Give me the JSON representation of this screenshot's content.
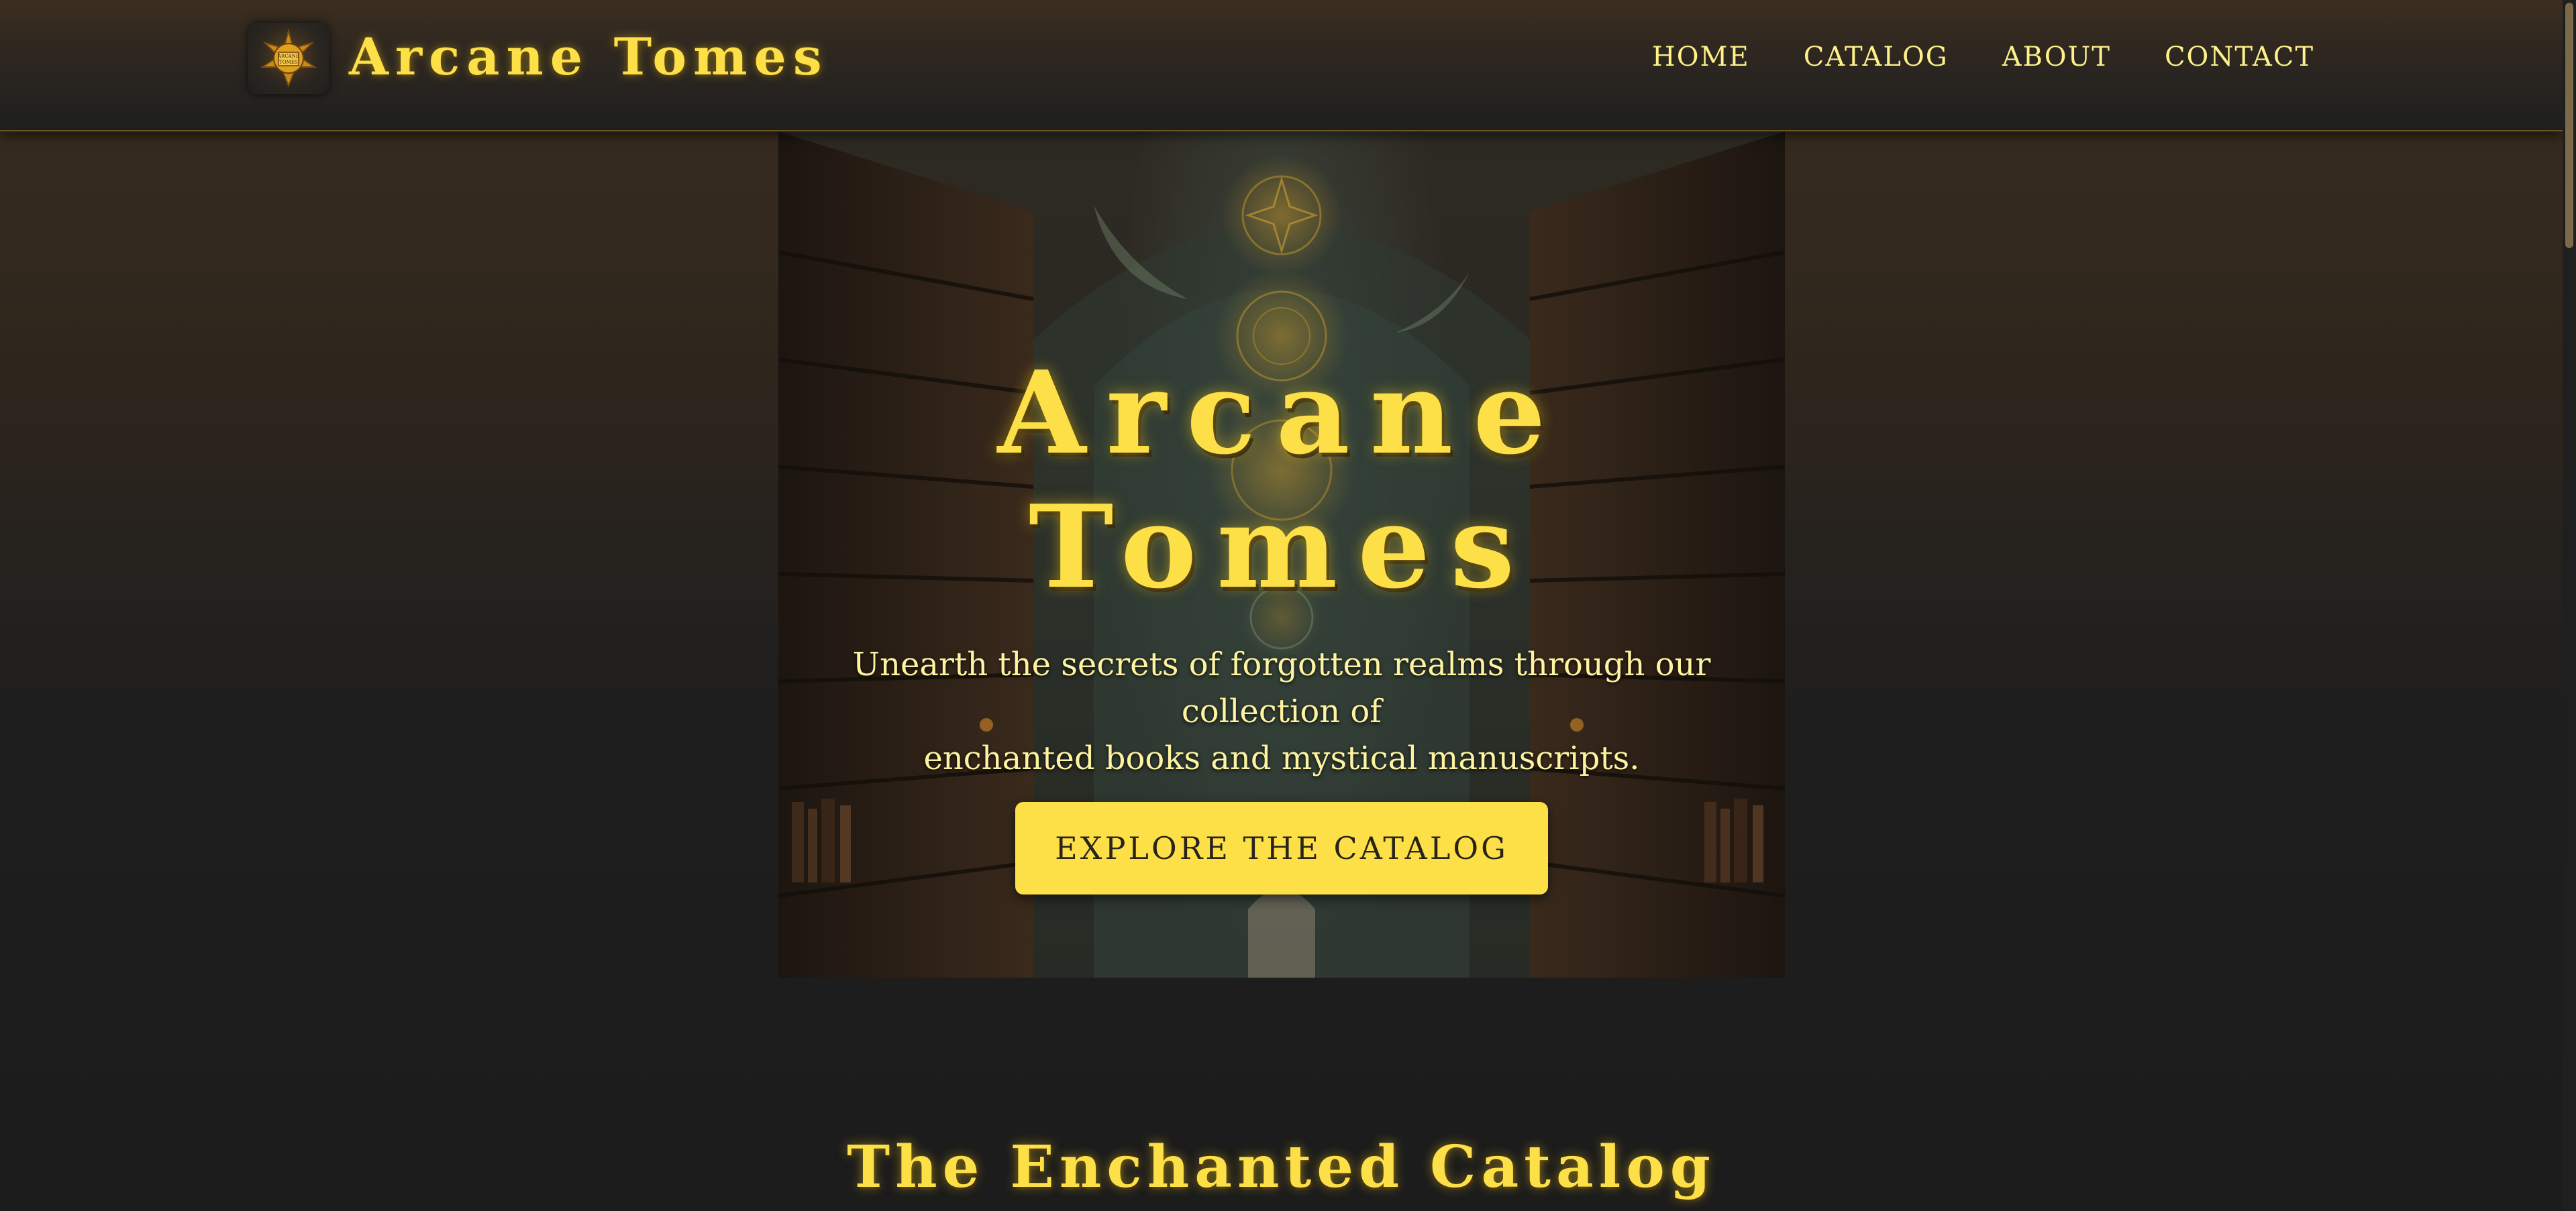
{
  "header": {
    "logo_text": "ARCANE TOMES",
    "brand": "Arcane Tomes",
    "nav": [
      {
        "label": "HOME"
      },
      {
        "label": "CATALOG"
      },
      {
        "label": "ABOUT"
      },
      {
        "label": "CONTACT"
      }
    ]
  },
  "hero": {
    "title": "Arcane Tomes",
    "subtitle_line1": "Unearth the secrets of forgotten realms through our collection of",
    "subtitle_line2": "enchanted books and mystical manuscripts.",
    "cta": "EXPLORE THE CATALOG"
  },
  "catalog": {
    "title": "The Enchanted Catalog"
  },
  "colors": {
    "accent": "#fde047",
    "accent_light": "#fef08a",
    "background_dark": "#1c1c1c",
    "background_warm": "#3b2d1f",
    "button_text": "#2a2418"
  }
}
